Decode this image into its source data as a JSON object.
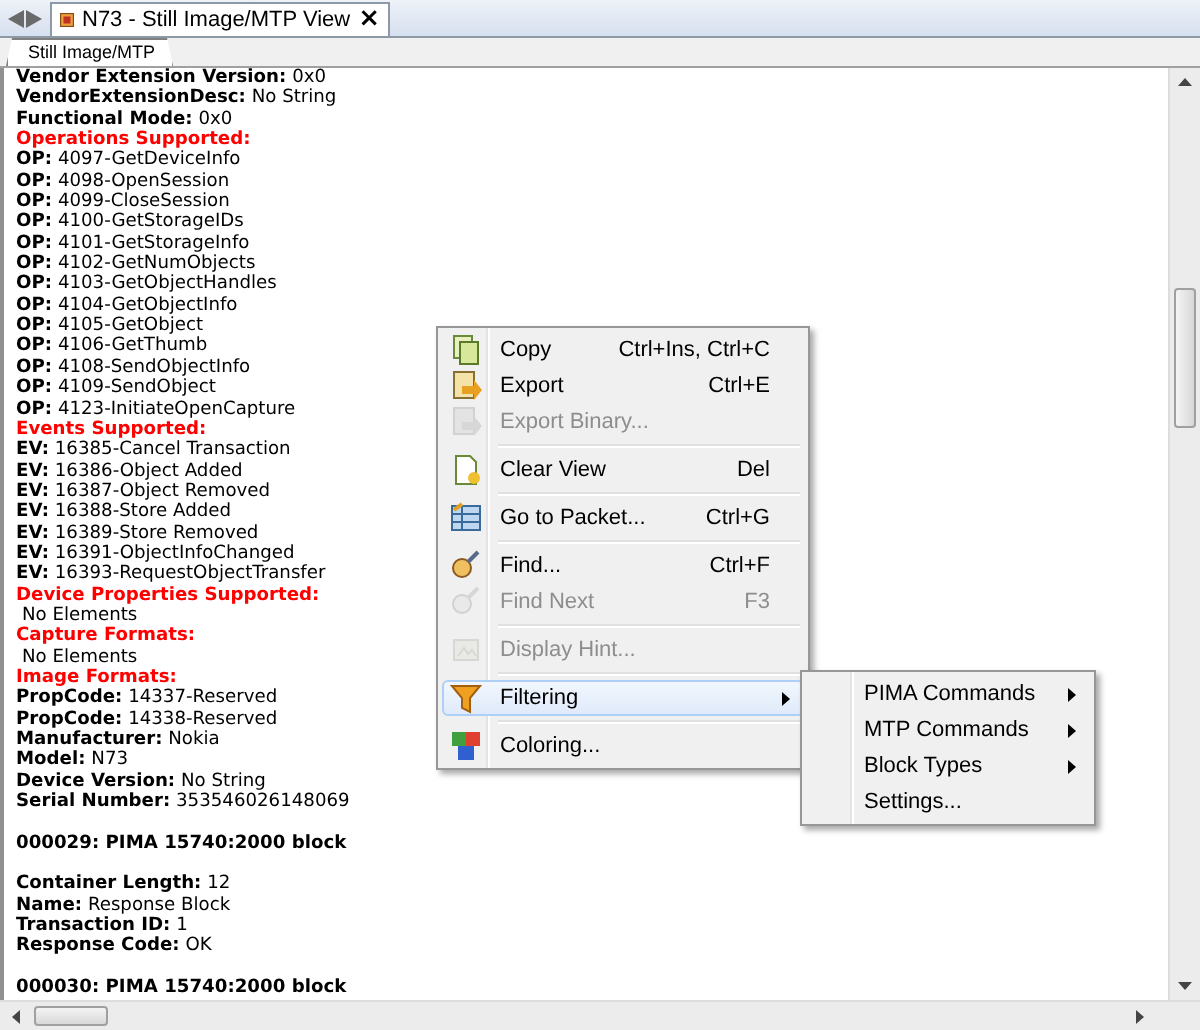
{
  "document_tab": {
    "title": "N73 - Still Image/MTP View",
    "close": "×",
    "selected": true
  },
  "subtabs": [
    {
      "label": "Still Image/MTP",
      "selected": true
    }
  ],
  "lines": [
    {
      "kind": "field",
      "label": "Vendor Extension Version:",
      "value": "0x0"
    },
    {
      "kind": "field",
      "label": "VendorExtensionDesc:",
      "value": "No String"
    },
    {
      "kind": "field",
      "label": "Functional Mode:",
      "value": "0x0"
    },
    {
      "kind": "heading",
      "text": "Operations Supported:"
    },
    {
      "kind": "field",
      "label": "OP:",
      "value": "4097-GetDeviceInfo"
    },
    {
      "kind": "field",
      "label": "OP:",
      "value": "4098-OpenSession"
    },
    {
      "kind": "field",
      "label": "OP:",
      "value": "4099-CloseSession"
    },
    {
      "kind": "field",
      "label": "OP:",
      "value": "4100-GetStorageIDs"
    },
    {
      "kind": "field",
      "label": "OP:",
      "value": "4101-GetStorageInfo"
    },
    {
      "kind": "field",
      "label": "OP:",
      "value": "4102-GetNumObjects"
    },
    {
      "kind": "field",
      "label": "OP:",
      "value": "4103-GetObjectHandles"
    },
    {
      "kind": "field",
      "label": "OP:",
      "value": "4104-GetObjectInfo"
    },
    {
      "kind": "field",
      "label": "OP:",
      "value": "4105-GetObject"
    },
    {
      "kind": "field",
      "label": "OP:",
      "value": "4106-GetThumb"
    },
    {
      "kind": "field",
      "label": "OP:",
      "value": "4108-SendObjectInfo"
    },
    {
      "kind": "field",
      "label": "OP:",
      "value": "4109-SendObject"
    },
    {
      "kind": "field",
      "label": "OP:",
      "value": "4123-InitiateOpenCapture"
    },
    {
      "kind": "heading",
      "text": "Events Supported:"
    },
    {
      "kind": "field",
      "label": "EV:",
      "value": "16385-Cancel Transaction"
    },
    {
      "kind": "field",
      "label": "EV:",
      "value": "16386-Object Added"
    },
    {
      "kind": "field",
      "label": "EV:",
      "value": "16387-Object Removed"
    },
    {
      "kind": "field",
      "label": "EV:",
      "value": "16388-Store Added"
    },
    {
      "kind": "field",
      "label": "EV:",
      "value": "16389-Store Removed"
    },
    {
      "kind": "field",
      "label": "EV:",
      "value": "16391-ObjectInfoChanged"
    },
    {
      "kind": "field",
      "label": "EV:",
      "value": "16393-RequestObjectTransfer"
    },
    {
      "kind": "heading",
      "text": "Device Properties Supported:"
    },
    {
      "kind": "plain",
      "text": "No Elements"
    },
    {
      "kind": "heading",
      "text": "Capture Formats:"
    },
    {
      "kind": "plain",
      "text": "No Elements"
    },
    {
      "kind": "heading",
      "text": "Image Formats:"
    },
    {
      "kind": "field",
      "label": "PropCode:",
      "value": "14337-Reserved"
    },
    {
      "kind": "field",
      "label": "PropCode:",
      "value": "14338-Reserved"
    },
    {
      "kind": "field",
      "label": "Manufacturer:",
      "value": "Nokia"
    },
    {
      "kind": "field",
      "label": "Model:",
      "value": "N73"
    },
    {
      "kind": "field",
      "label": "Device Version:",
      "value": "No String"
    },
    {
      "kind": "field",
      "label": "Serial Number:",
      "value": "353546026148069"
    },
    {
      "kind": "blank"
    },
    {
      "kind": "block",
      "text": "000029: PIMA 15740:2000 block"
    },
    {
      "kind": "blank"
    },
    {
      "kind": "field",
      "label": "Container Length:",
      "value": "12"
    },
    {
      "kind": "field",
      "label": "Name:",
      "value": "Response Block"
    },
    {
      "kind": "field",
      "label": "Transaction ID:",
      "value": "1"
    },
    {
      "kind": "field",
      "label": "Response Code:",
      "value": "OK"
    },
    {
      "kind": "blank"
    },
    {
      "kind": "block",
      "text": "000030: PIMA 15740:2000 block"
    }
  ],
  "context_menu": {
    "items": [
      {
        "kind": "item",
        "label": "Copy",
        "shortcut": "Ctrl+Ins, Ctrl+C",
        "disabled": false,
        "selected": false,
        "submenu": false
      },
      {
        "kind": "item",
        "label": "Export",
        "shortcut": "Ctrl+E",
        "disabled": false,
        "selected": false,
        "submenu": false
      },
      {
        "kind": "item",
        "label": "Export Binary...",
        "disabled": true,
        "selected": false,
        "submenu": false
      },
      {
        "kind": "separator"
      },
      {
        "kind": "item",
        "label": "Clear View",
        "shortcut": "Del",
        "disabled": false,
        "selected": false,
        "submenu": false
      },
      {
        "kind": "separator"
      },
      {
        "kind": "item",
        "label": "Go to Packet...",
        "shortcut": "Ctrl+G",
        "disabled": false,
        "selected": false,
        "submenu": false
      },
      {
        "kind": "separator"
      },
      {
        "kind": "item",
        "label": "Find...",
        "shortcut": "Ctrl+F",
        "disabled": false,
        "selected": false,
        "submenu": false
      },
      {
        "kind": "item",
        "label": "Find Next",
        "shortcut": "F3",
        "disabled": true,
        "selected": false,
        "submenu": false
      },
      {
        "kind": "separator"
      },
      {
        "kind": "item",
        "label": "Display Hint...",
        "disabled": true,
        "selected": false,
        "submenu": false
      },
      {
        "kind": "separator"
      },
      {
        "kind": "item",
        "label": "Filtering",
        "disabled": false,
        "selected": true,
        "submenu": true
      },
      {
        "kind": "separator"
      },
      {
        "kind": "item",
        "label": "Coloring...",
        "disabled": false,
        "selected": false,
        "submenu": false
      }
    ]
  },
  "submenu": {
    "items": [
      {
        "label": "PIMA Commands",
        "submenu": true
      },
      {
        "label": "MTP Commands",
        "submenu": true
      },
      {
        "label": "Block Types",
        "submenu": true
      },
      {
        "label": "Settings...",
        "submenu": false
      }
    ]
  }
}
